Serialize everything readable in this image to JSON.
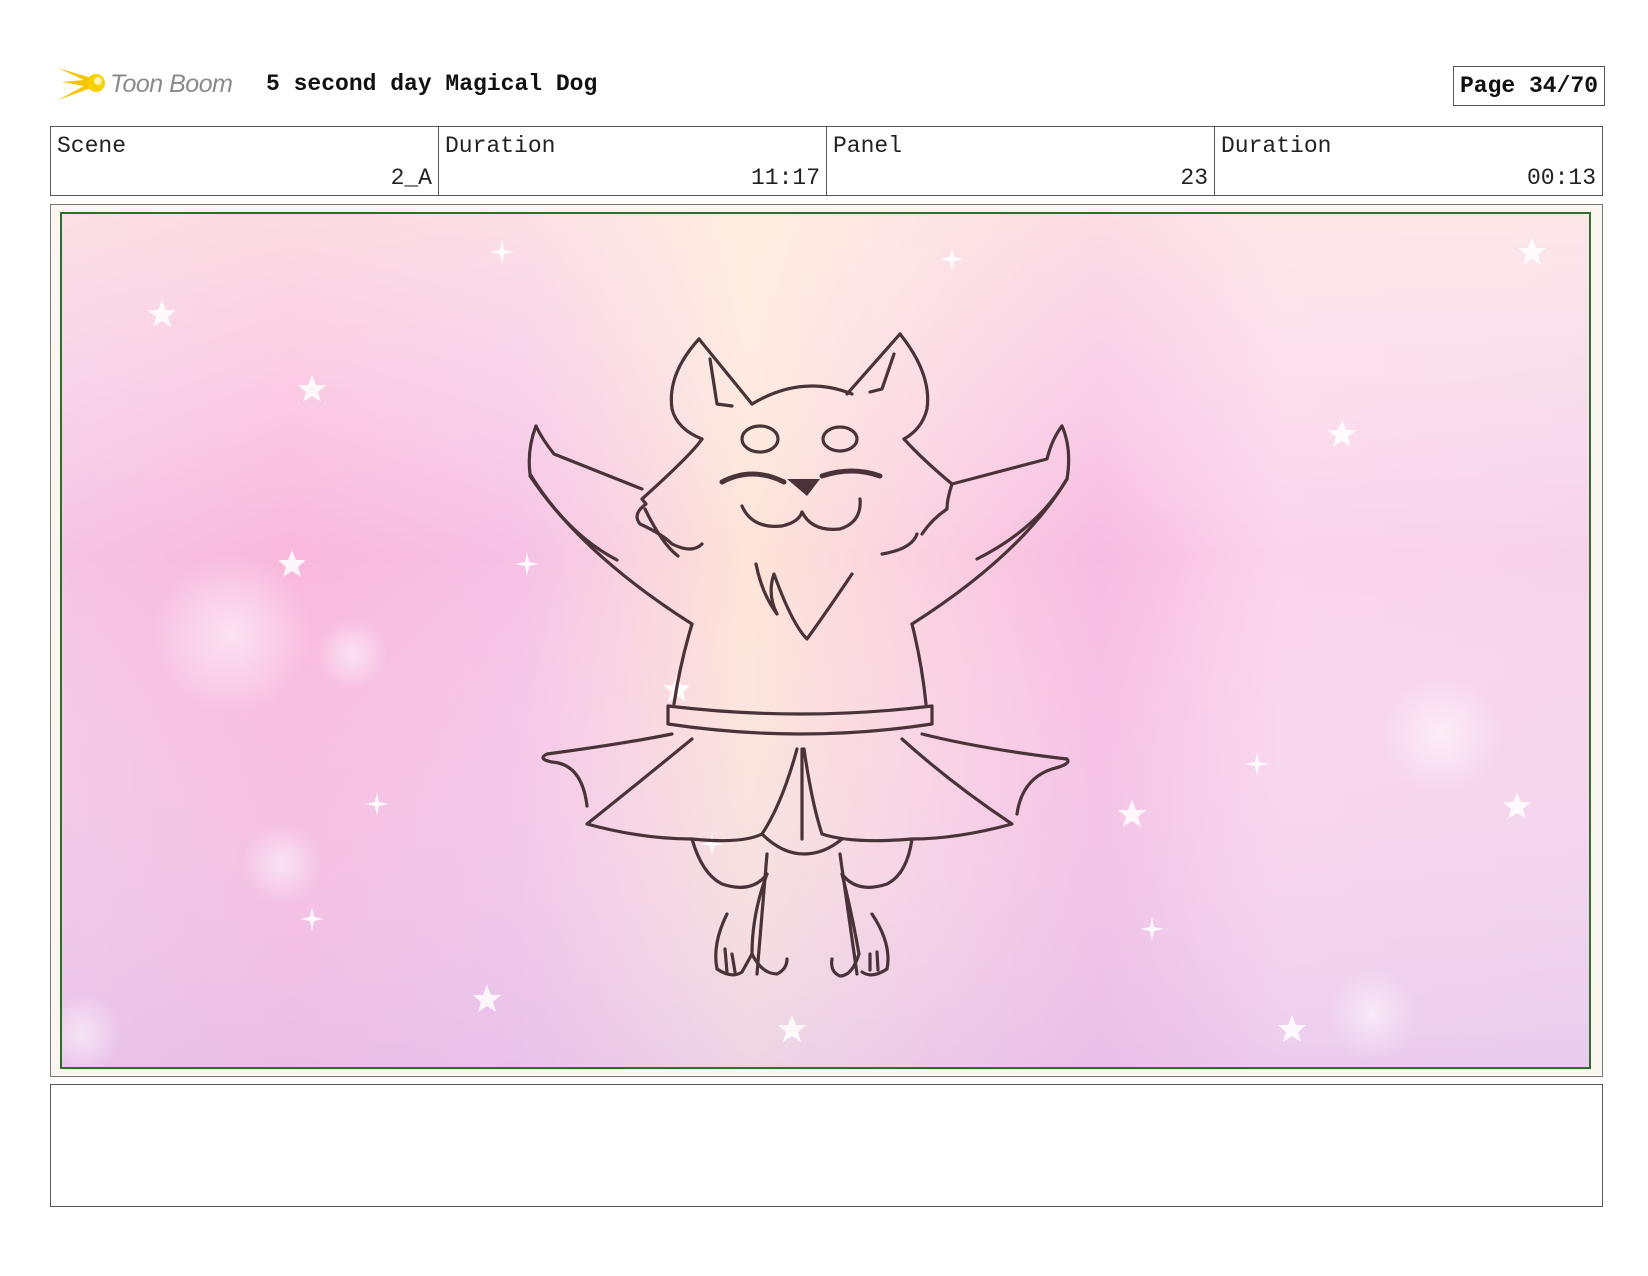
{
  "header": {
    "logo_text": "Toon Boom",
    "title": "5 second day Magical Dog",
    "page": "Page 34/70"
  },
  "info": [
    {
      "label": "Scene",
      "value": "2_A"
    },
    {
      "label": "Duration",
      "value": "11:17"
    },
    {
      "label": "Panel",
      "value": "23"
    },
    {
      "label": "Duration",
      "value": "00:13"
    }
  ],
  "panel": {
    "image": "dog-in-tutu-sketch",
    "background": "pink-sparkle-gradient"
  },
  "notes": {
    "text": ""
  },
  "colors": {
    "border": "#555555",
    "frame": "#2f6e2f",
    "sketch_line": "#4a3338",
    "bg_pink": "#f7c3e0",
    "bg_peach": "#fde6d6"
  }
}
